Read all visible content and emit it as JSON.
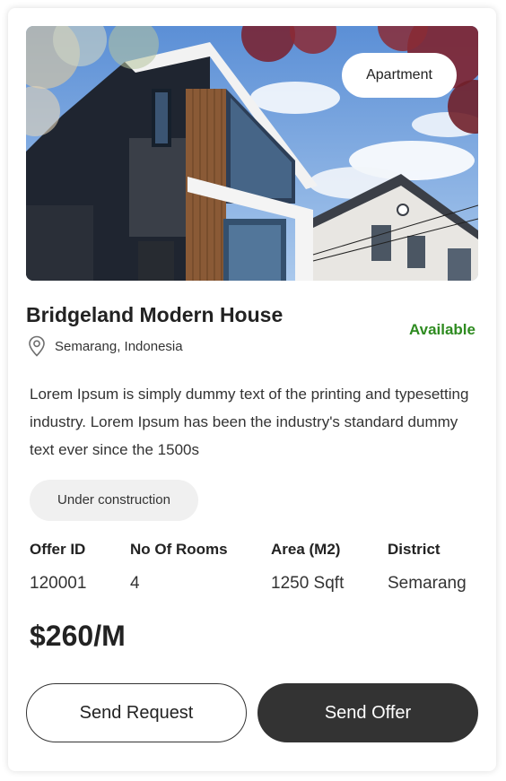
{
  "listing": {
    "type_tag": "Apartment",
    "title": "Bridgeland Modern House",
    "location": "Semarang, Indonesia",
    "status": "Available",
    "description": "Lorem Ipsum is simply dummy text of the printing and typesetting industry. Lorem Ipsum has been the industry's standard dummy text ever since the 1500s",
    "construction_tag": "Under construction",
    "specs": [
      {
        "label": "Offer ID",
        "value": "120001"
      },
      {
        "label": "No Of Rooms",
        "value": "4"
      },
      {
        "label": "Area (M2)",
        "value": "1250 Sqft"
      },
      {
        "label": "District",
        "value": "Semarang"
      }
    ],
    "price": "$260/M"
  },
  "actions": {
    "send_request": "Send Request",
    "send_offer": "Send Offer"
  },
  "colors": {
    "status_available": "#2e8b20",
    "primary_button": "#333333",
    "tag_background": "#f0f0f0"
  },
  "icons": {
    "location": "map-pin-icon"
  }
}
